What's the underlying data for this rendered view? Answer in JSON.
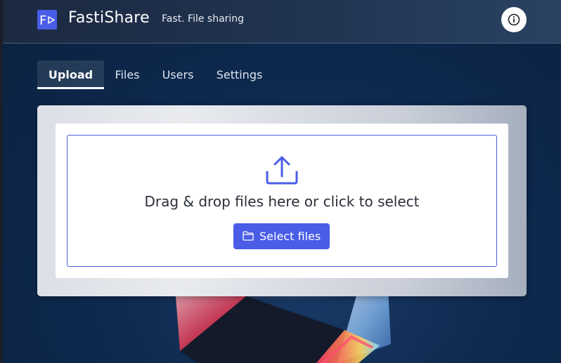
{
  "header": {
    "logo_text": "F",
    "app_name": "FastiShare",
    "tagline": "Fast. File sharing",
    "info_icon": "info-circle-icon"
  },
  "tabs": [
    {
      "label": "Upload",
      "active": true
    },
    {
      "label": "Files",
      "active": false
    },
    {
      "label": "Users",
      "active": false
    },
    {
      "label": "Settings",
      "active": false
    }
  ],
  "upload": {
    "upload_icon": "upload-icon",
    "drop_text": "Drag & drop files here or click to select",
    "select_button": {
      "label": "Select files",
      "icon": "folder-icon"
    }
  },
  "colors": {
    "accent": "#4a5de6",
    "header_bg": "#1f3050",
    "page_bg": "#0e2a50"
  }
}
